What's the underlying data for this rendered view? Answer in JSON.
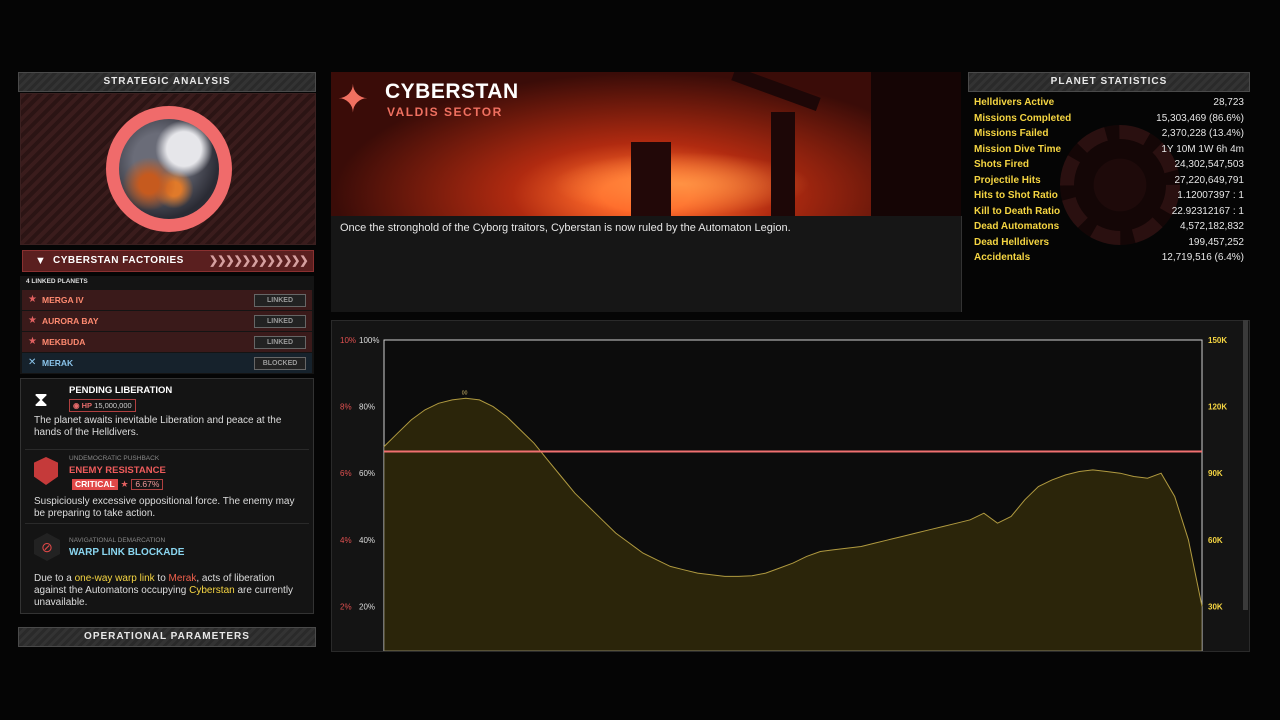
{
  "left": {
    "strategic_title": "STRATEGIC ANALYSIS",
    "factory_label": "CYBERSTAN FACTORIES",
    "factory_chevrons": "❯❯❯❯❯❯❯❯❯❯❯❯",
    "linked_caption": "4 LINKED PLANETS",
    "linked": [
      {
        "name": "MERGA IV",
        "status": "LINKED"
      },
      {
        "name": "AURORA BAY",
        "status": "LINKED"
      },
      {
        "name": "MEKBUDA",
        "status": "LINKED"
      },
      {
        "name": "MERAK",
        "status": "BLOCKED"
      }
    ],
    "pending": {
      "title": "PENDING LIBERATION",
      "hp_label": "HP",
      "hp_value": "15,000,000",
      "desc": "The planet awaits inevitable Liberation and peace at the hands of the Helldivers."
    },
    "resistance": {
      "caption": "UNDEMOCRATIC PUSHBACK",
      "title": "ENEMY RESISTANCE",
      "badge": "CRITICAL",
      "pct": "6.67%",
      "desc": "Suspiciously excessive oppositional force. The enemy may be preparing to take action."
    },
    "warp": {
      "caption": "NAVIGATIONAL DEMARCATION",
      "title": "WARP LINK BLOCKADE",
      "d1": "Due to a ",
      "h1": "one-way warp link",
      "d2": " to ",
      "h2": "Merak",
      "d3": ", acts of liberation against the Automatons occupying ",
      "h3": "Cyberstan",
      "d4": " are currently unavailable."
    },
    "operational_title": "OPERATIONAL PARAMETERS"
  },
  "banner": {
    "name": "CYBERSTAN",
    "sector": "VALDIS SECTOR",
    "description": "Once the stronghold of the Cyborg traitors, Cyberstan is now ruled by the Automaton Legion."
  },
  "stats": {
    "title": "PLANET STATISTICS",
    "rows": [
      {
        "k": "Helldivers Active",
        "v": "28,723"
      },
      {
        "k": "Missions Completed",
        "v": "15,303,469 (86.6%)"
      },
      {
        "k": "Missions Failed",
        "v": "2,370,228 (13.4%)"
      },
      {
        "k": "Mission Dive Time",
        "v": "1Y 10M 1W 6h 4m"
      },
      {
        "k": "Shots Fired",
        "v": "24,302,547,503"
      },
      {
        "k": "Projectile Hits",
        "v": "27,220,649,791"
      },
      {
        "k": "Hits to Shot Ratio",
        "v": "1.12007397 : 1"
      },
      {
        "k": "Kill to Death Ratio",
        "v": "22.92312167 : 1"
      },
      {
        "k": "Dead Automatons",
        "v": "4,572,182,832"
      },
      {
        "k": "Dead Helldivers",
        "v": "199,457,252"
      },
      {
        "k": "Accidentals",
        "v": "12,719,516 (6.4%)"
      }
    ]
  },
  "colors": {
    "accent_red": "#f07060",
    "stat_yellow": "#f5d542",
    "warp_cyan": "#8ad6f0"
  },
  "chart_data": {
    "type": "area",
    "left_red_ticks": [
      "10%",
      "8%",
      "6%",
      "4%",
      "2%"
    ],
    "left_ticks": [
      "100%",
      "80%",
      "60%",
      "40%",
      "20%"
    ],
    "right_ticks": [
      "150K",
      "120K",
      "90K",
      "60K",
      "30K"
    ],
    "y_range_percent": [
      0,
      100
    ],
    "peak_marker": "00",
    "threshold_percent": 66.5,
    "series": [
      {
        "values": [
          68,
          72,
          76,
          79,
          81,
          82,
          82.5,
          82,
          80,
          77,
          73,
          69,
          64,
          59,
          54,
          50,
          46,
          42,
          39,
          36,
          34,
          32,
          31,
          30,
          29.5,
          29,
          29,
          29.2,
          30,
          31.5,
          33,
          35,
          36.5,
          37,
          37.5,
          38,
          39,
          40,
          41,
          42,
          43,
          44,
          45,
          46,
          48,
          45,
          47,
          52,
          56,
          58,
          59.5,
          60.5,
          61,
          60.5,
          60,
          59,
          58.5,
          60,
          53,
          40,
          20
        ]
      }
    ]
  }
}
